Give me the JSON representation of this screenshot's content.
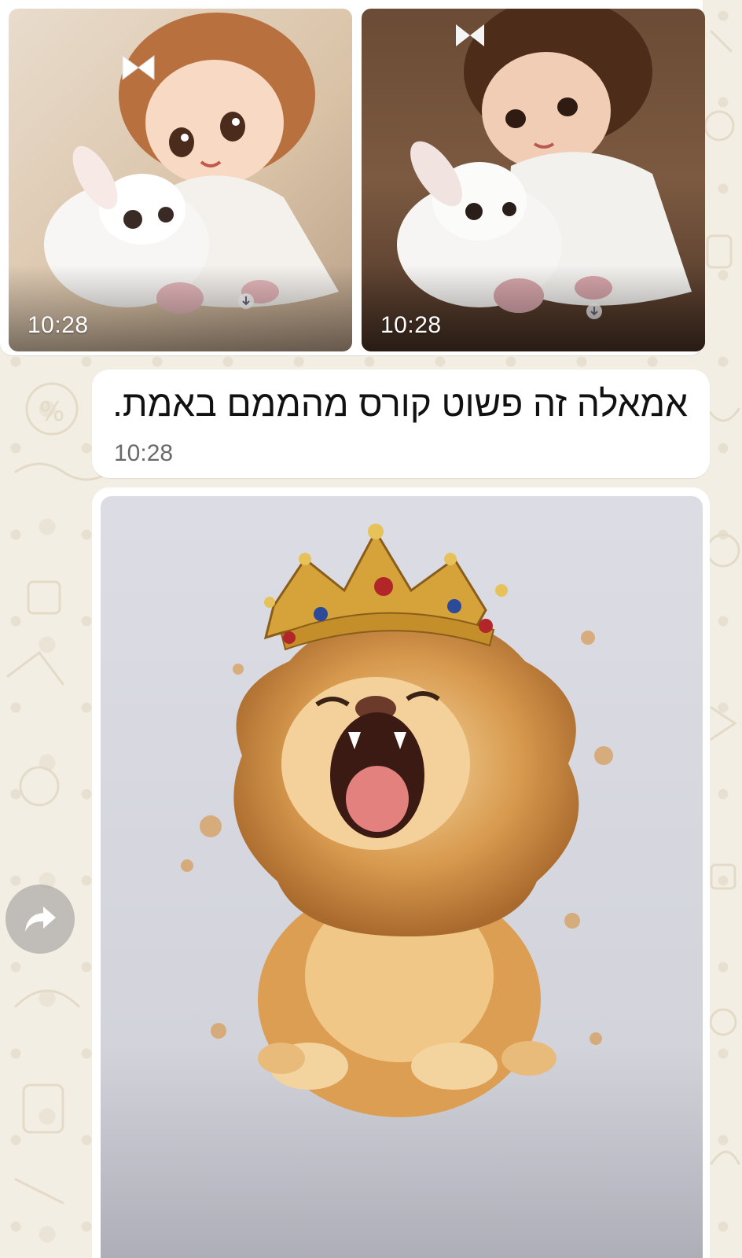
{
  "chat": {
    "album": {
      "photos": [
        {
          "time": "10:28",
          "subject": "girl-with-bunny-illustration"
        },
        {
          "time": "10:28",
          "subject": "girl-with-bunny-realistic"
        }
      ]
    },
    "text_message": {
      "text": "אמאלה זה פשוט קורס מהממם באמת.",
      "time": "10:28"
    },
    "image_message": {
      "subject": "crowned-lion-cub-watercolor"
    }
  },
  "icons": {
    "forward": "forward-arrow-icon",
    "download_badge": "download-arrow-icon"
  },
  "colors": {
    "wallpaper": "#f3eee3",
    "bubble": "#ffffff",
    "timestamp_text": "#6a6a6a",
    "overlay_time_text": "#ffffff",
    "forward_button": "#969696"
  }
}
